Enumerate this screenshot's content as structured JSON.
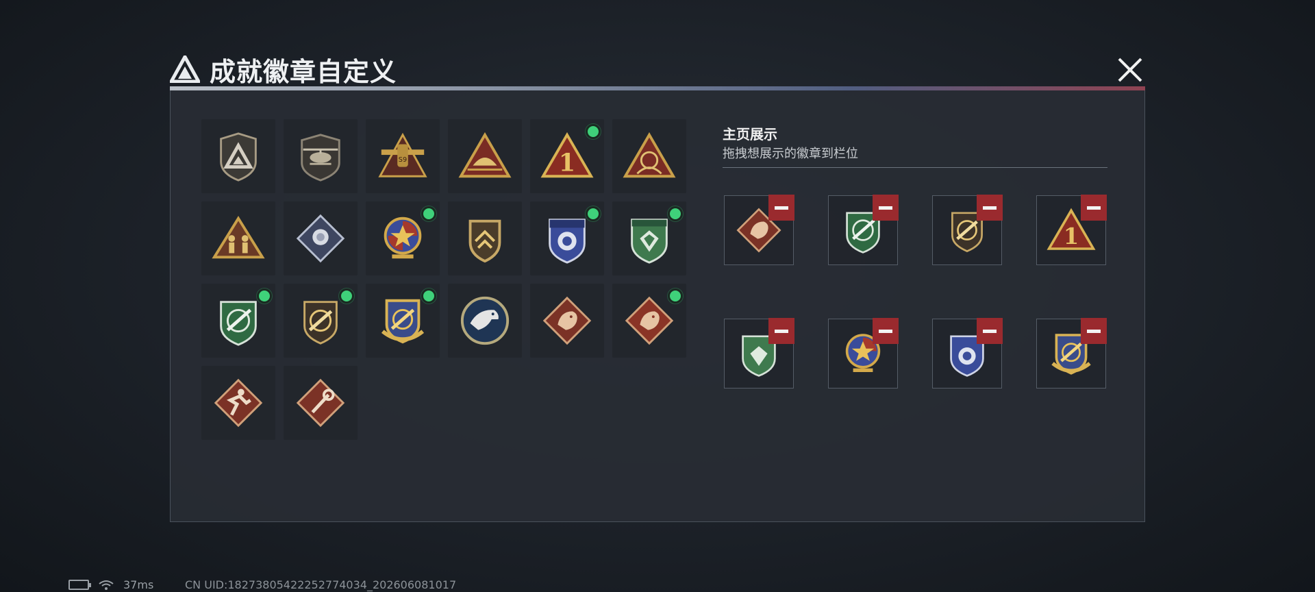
{
  "dialog": {
    "title": "成就徽章自定义",
    "close_icon": "close-icon"
  },
  "badges": [
    {
      "icon": "shield-mountain-badge",
      "new": false
    },
    {
      "icon": "helicopter-badge",
      "new": false
    },
    {
      "icon": "cargo-plane-badge",
      "new": false
    },
    {
      "icon": "sunrise-triangle-badge",
      "new": false
    },
    {
      "icon": "number-one-triangle-badge",
      "new": true
    },
    {
      "icon": "globe-triangle-badge",
      "new": false
    },
    {
      "icon": "soldiers-triangle-badge",
      "new": false
    },
    {
      "icon": "rose-diamond-badge",
      "new": false
    },
    {
      "icon": "star-medal-badge",
      "new": true
    },
    {
      "icon": "winged-shield-badge",
      "new": false
    },
    {
      "icon": "blue-police-shield-badge",
      "new": true
    },
    {
      "icon": "green-gem-shield-badge",
      "new": true
    },
    {
      "icon": "green-rifle-shield-badge",
      "new": true
    },
    {
      "icon": "brown-rifle-shield-badge",
      "new": true
    },
    {
      "icon": "gold-rifle-shield-badge",
      "new": true
    },
    {
      "icon": "eagle-round-badge",
      "new": false
    },
    {
      "icon": "dragon-diamond-badge",
      "new": false
    },
    {
      "icon": "dragon-diamond-badge-2",
      "new": true
    },
    {
      "icon": "runner-diamond-badge",
      "new": false
    },
    {
      "icon": "wrench-diamond-badge",
      "new": false
    }
  ],
  "showcase": {
    "title": "主页展示",
    "subtitle": "拖拽想展示的徽章到栏位",
    "slots": [
      {
        "icon": "dragon-diamond-badge"
      },
      {
        "icon": "green-rifle-shield-badge"
      },
      {
        "icon": "brown-rifle-shield-badge"
      },
      {
        "icon": "number-one-triangle-badge"
      },
      {
        "icon": "green-gem-shield-badge"
      },
      {
        "icon": "star-medal-badge"
      },
      {
        "icon": "blue-police-shield-badge"
      },
      {
        "icon": "gold-rifle-shield-badge"
      }
    ]
  },
  "status_bar": {
    "ping": "37ms",
    "uid": "CN UID:18273805422252774034_202606081017"
  },
  "colors": {
    "new_dot": "#3fd17a",
    "remove": "#9a2a2e",
    "gold": "#c9a04a",
    "red_bronze": "#8e3a2c",
    "green": "#3f7a4e",
    "blue": "#3a4c9a"
  }
}
